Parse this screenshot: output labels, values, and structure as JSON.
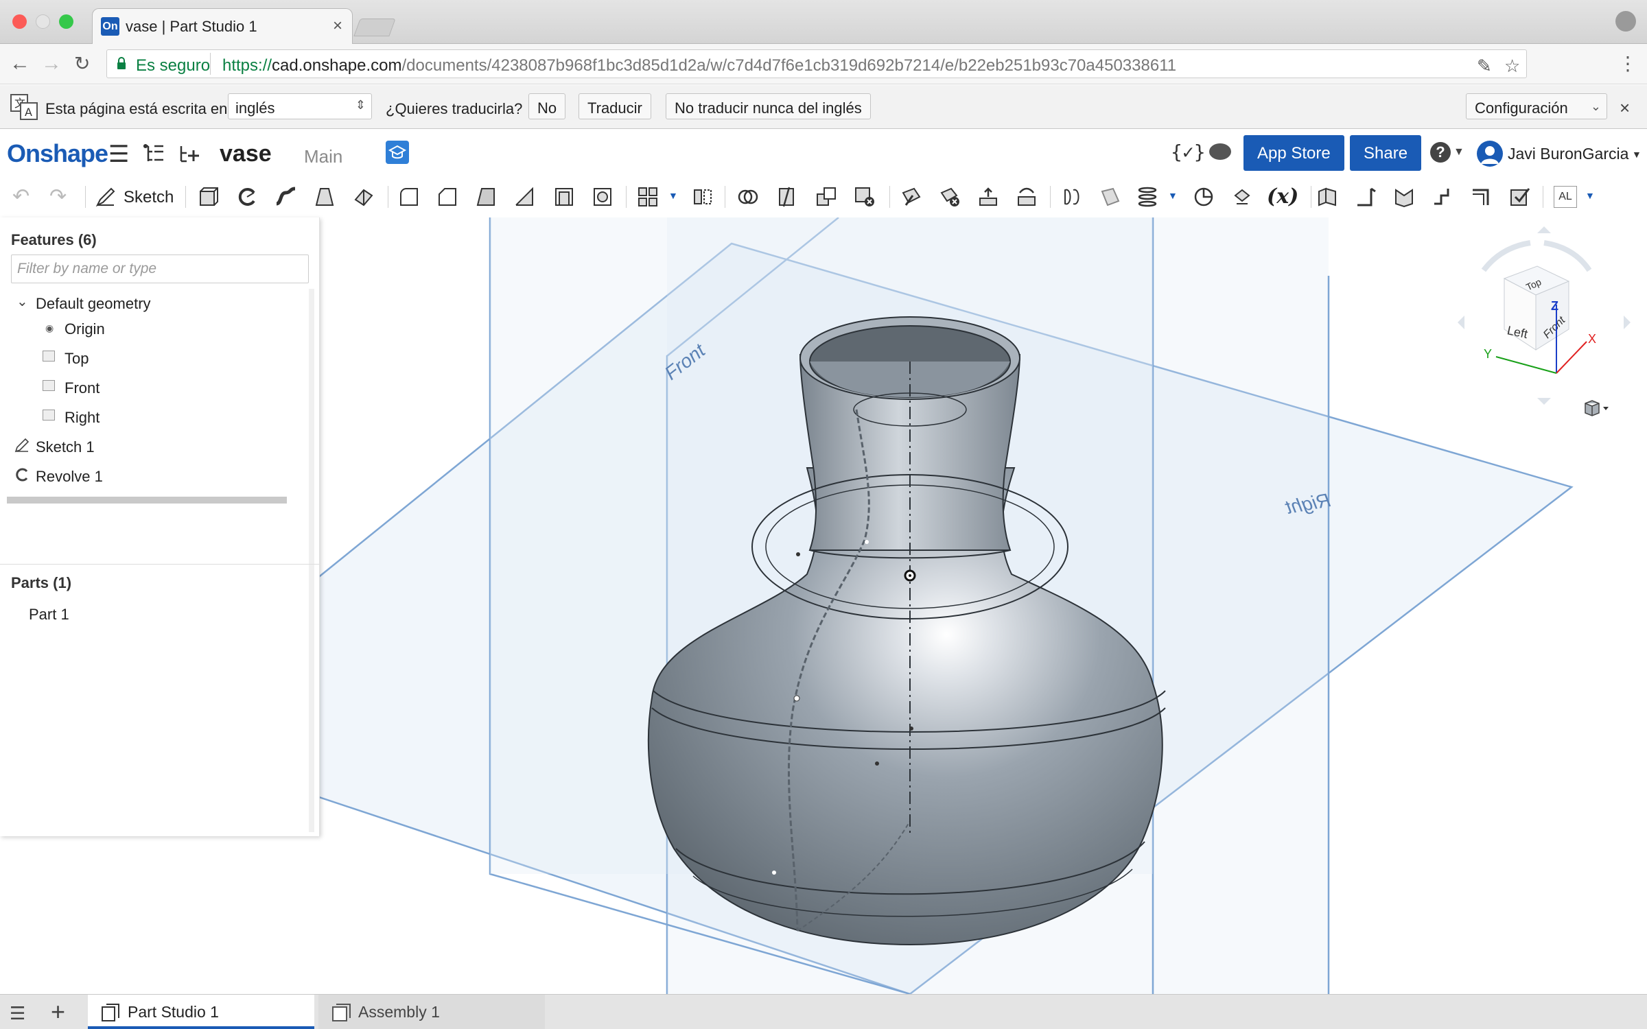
{
  "browser": {
    "tab_title": "vase | Part Studio 1",
    "tab_favicon": "On",
    "tab_close": "×",
    "secure_label": "Es seguro",
    "url_scheme": "https://",
    "url_host": "cad.onshape.com",
    "url_path": "/documents/4238087b968f1bc3d85d1d2a/w/c7d4d7f6e1cb319d692b7214/e/b22eb251b93c70a450338611"
  },
  "translate_bar": {
    "prompt": "Esta página está escrita en",
    "language": "inglés",
    "question": "¿Quieres traducirla?",
    "no_label": "No",
    "translate_label": "Traducir",
    "never_label": "No traducir nunca del inglés",
    "config_label": "Configuración",
    "close": "×"
  },
  "header": {
    "logo": "Onshape",
    "document_name": "vase",
    "workspace": "Main",
    "app_store_label": "App Store",
    "share_label": "Share",
    "help": "?",
    "user_name": "Javi BuronGarcia"
  },
  "toolbar": {
    "sketch_label": "Sketch",
    "variables_label": "(x)",
    "named_views_label": "AL"
  },
  "feature_panel": {
    "heading": "Features (6)",
    "filter_placeholder": "Filter by name or type",
    "group_label": "Default geometry",
    "items": [
      {
        "label": "Origin",
        "icon": "origin-icon"
      },
      {
        "label": "Top",
        "icon": "plane-icon"
      },
      {
        "label": "Front",
        "icon": "plane-icon"
      },
      {
        "label": "Right",
        "icon": "plane-icon"
      },
      {
        "label": "Sketch 1",
        "icon": "sketch-icon"
      },
      {
        "label": "Revolve 1",
        "icon": "revolve-icon"
      }
    ],
    "parts_heading": "Parts (1)",
    "parts": [
      {
        "label": "Part 1"
      }
    ]
  },
  "viewport": {
    "plane_front_label": "Front",
    "plane_right_label": "Right",
    "accent_color": "#7ea6d4",
    "body_color": "#8f9aa5"
  },
  "viewcube": {
    "top": "Top",
    "left": "Left",
    "front": "Front",
    "axis_z": "Z",
    "axis_x": "X",
    "axis_y": "Y"
  },
  "bottom_tabs": [
    {
      "label": "Part Studio 1",
      "active": true
    },
    {
      "label": "Assembly 1",
      "active": false
    }
  ]
}
